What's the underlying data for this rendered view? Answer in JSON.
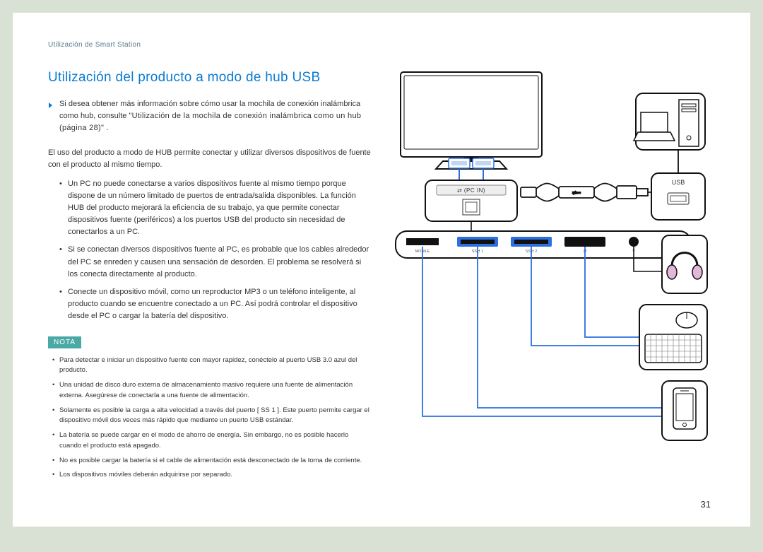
{
  "breadcrumb": "Utilización de Smart Station",
  "title": "Utilización del producto a modo de hub USB",
  "intro": {
    "prefix": "Si desea obtener más información sobre cómo usar la mochila de conexión inalámbrica como hub, consulte ",
    "link": "\"Utilización de la mochila de conexión inalámbrica como un hub (página 28)\"",
    "suffix": "."
  },
  "para1": "El uso del producto a modo de HUB permite conectar y utilizar diversos dispositivos de fuente con el producto al mismo tiempo.",
  "bullets": [
    "Un PC no puede conectarse a varios dispositivos fuente al mismo tiempo porque dispone de un número limitado de puertos de entrada/salida disponibles. La función HUB del producto mejorará la eficiencia de su trabajo, ya que permite conectar dispositivos fuente (periféricos) a los puertos USB del producto sin necesidad de conectarlos a un PC.",
    "Si se conectan diversos dispositivos fuente al PC, es probable que los cables alrededor del PC se enreden y causen una sensación de desorden. El problema se resolverá si los conecta directamente al producto.",
    "Conecte un dispositivo móvil, como un reproductor MP3 o un teléfono inteligente, al producto cuando se encuentre conectado a un PC. Así podrá controlar el dispositivo desde el PC o cargar la batería del dispositivo."
  ],
  "nota_label": "NOTA",
  "notes": [
    "Para detectar e iniciar un dispositivo fuente con mayor rapidez, conéctelo al puerto USB 3.0 azul del producto.",
    "Una unidad de disco duro externa de almacenamiento masivo requiere una fuente de alimentación externa. Asegúrese de conectarla a una fuente de alimentación.",
    "Solamente es posible la carga a alta velocidad a través del puerto [ SS 1 ]. Este puerto permite cargar el dispositivo móvil dos veces más rápido que mediante un puerto USB estándar.",
    "La batería se puede cargar en el modo de ahorro de energía. Sin embargo, no es posible hacerlo cuando el producto está apagado.",
    "No es posible cargar la batería si el cable de alimentación está desconectado de la toma de corriente.",
    "Los dispositivos móviles deberán adquirirse por separado."
  ],
  "diagram": {
    "pc_in_label": "(PC IN)",
    "usb_label": "USB",
    "port_labels": {
      "mobile": "MOBILE",
      "ss1": "1",
      "ss2": "2"
    }
  },
  "page_number": "31"
}
